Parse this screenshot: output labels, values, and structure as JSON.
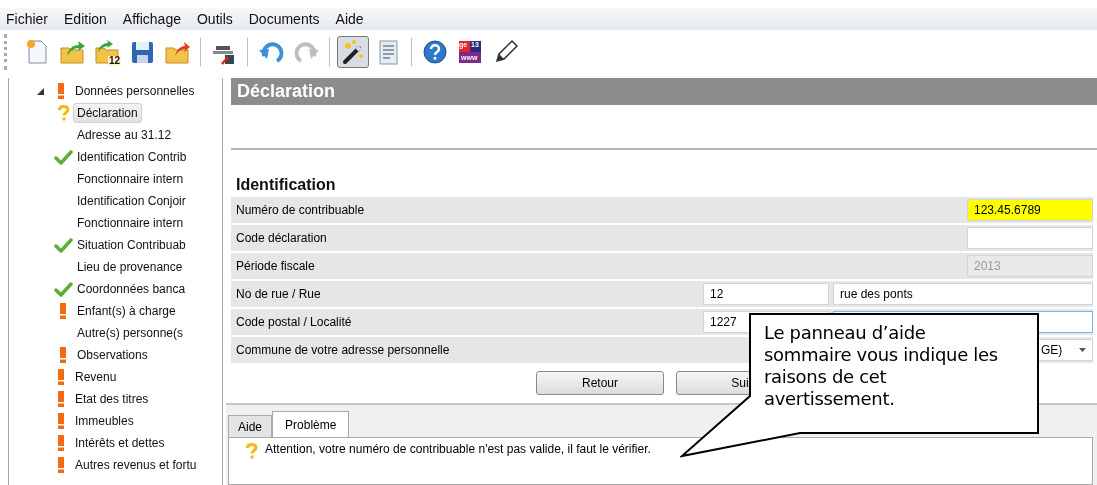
{
  "menu": [
    "Fichier",
    "Edition",
    "Affichage",
    "Outils",
    "Documents",
    "Aide"
  ],
  "toolbar": [
    {
      "kind": "new-document",
      "pressed": false,
      "disabled": false
    },
    {
      "kind": "open-folder",
      "pressed": false,
      "disabled": false
    },
    {
      "kind": "year-folder",
      "badge": "12",
      "pressed": false,
      "disabled": false
    },
    {
      "kind": "save",
      "pressed": false,
      "disabled": false
    },
    {
      "kind": "export-folder",
      "pressed": false,
      "disabled": false
    },
    {
      "kind": "separator"
    },
    {
      "kind": "print",
      "pressed": false,
      "disabled": false
    },
    {
      "kind": "separator"
    },
    {
      "kind": "undo",
      "pressed": false,
      "disabled": false
    },
    {
      "kind": "redo",
      "pressed": false,
      "disabled": true
    },
    {
      "kind": "separator"
    },
    {
      "kind": "wand",
      "pressed": true,
      "disabled": false
    },
    {
      "kind": "form",
      "pressed": false,
      "disabled": false
    },
    {
      "kind": "separator"
    },
    {
      "kind": "help",
      "pressed": false,
      "disabled": false
    },
    {
      "kind": "web",
      "badge_lines": [
        "ge",
        "13",
        "www"
      ],
      "pressed": false,
      "disabled": false
    },
    {
      "kind": "pencil",
      "pressed": false,
      "disabled": false
    }
  ],
  "tree": [
    {
      "label": "Données personnelles",
      "kind": "warning",
      "selected": false,
      "expanded": true,
      "children": [
        {
          "label": "Déclaration",
          "kind": "question",
          "selected": true
        },
        {
          "label": "Adresse au 31.12",
          "kind": "plain",
          "selected": false
        },
        {
          "label": "Identification Contrib",
          "kind": "valid",
          "selected": false
        },
        {
          "label": "Fonctionnaire intern",
          "kind": "plain",
          "selected": false
        },
        {
          "label": "Identification Conjoir",
          "kind": "plain",
          "selected": false
        },
        {
          "label": "Fonctionnaire intern",
          "kind": "plain",
          "selected": false
        },
        {
          "label": "Situation Contribuab",
          "kind": "valid",
          "selected": false
        },
        {
          "label": "Lieu de provenance",
          "kind": "plain",
          "selected": false
        },
        {
          "label": "Coordonnées banca",
          "kind": "valid",
          "selected": false
        },
        {
          "label": "Enfant(s) à charge",
          "kind": "warning",
          "selected": false
        },
        {
          "label": "Autre(s) personne(s",
          "kind": "plain",
          "selected": false
        },
        {
          "label": "Observations",
          "kind": "warning",
          "selected": false
        }
      ]
    },
    {
      "label": "Revenu",
      "kind": "warning",
      "selected": false
    },
    {
      "label": "Etat des titres",
      "kind": "warning",
      "selected": false
    },
    {
      "label": "Immeubles",
      "kind": "warning",
      "selected": false
    },
    {
      "label": "Intérêts et dettes",
      "kind": "warning",
      "selected": false
    },
    {
      "label": "Autres revenus et fortu",
      "kind": "warning",
      "selected": false
    }
  ],
  "page_title": "Déclaration",
  "section_title": "Identification",
  "form_rows": [
    {
      "label": "Numéro de contribuable",
      "kind": "single",
      "fields": [
        {
          "value": "123.45.6789",
          "invalid": true,
          "disabled": false,
          "focused": false
        }
      ]
    },
    {
      "label": "Code déclaration",
      "kind": "single",
      "fields": [
        {
          "invalid": false,
          "disabled": false,
          "focused": false
        }
      ]
    },
    {
      "label": "Période fiscale",
      "kind": "single",
      "fields": [
        {
          "value": "2013",
          "invalid": false,
          "disabled": true,
          "focused": false
        }
      ]
    },
    {
      "label": "No de rue / Rue",
      "kind": "pair",
      "fields": [
        {
          "value": "12",
          "invalid": false,
          "disabled": false,
          "focused": false
        },
        {
          "value": "rue des ponts",
          "invalid": false,
          "disabled": false,
          "focused": false
        }
      ]
    },
    {
      "label": "Code postal / Localité",
      "kind": "pair",
      "fields": [
        {
          "value": "1227",
          "invalid": false,
          "disabled": false,
          "focused": false
        },
        {
          "invalid": false,
          "disabled": false,
          "focused": true
        }
      ]
    },
    {
      "label": "Commune de votre adresse personnelle",
      "kind": "dropdown",
      "fields": [
        {
          "value": "GE)",
          "invalid": false,
          "disabled": false,
          "focused": false
        }
      ]
    }
  ],
  "buttons": [
    "Retour",
    "Sui"
  ],
  "bottom_tabs": [
    {
      "label": "Aide",
      "selected": false
    },
    {
      "label": "Problème",
      "selected": true
    }
  ],
  "message": {
    "kind": "question",
    "text": "Attention, votre numéro de contribuable n'est pas valide, il faut le vérifier."
  },
  "callout": {
    "text": "Le panneau d’aide sommaire vous indique les raisons de cet avertissement."
  }
}
